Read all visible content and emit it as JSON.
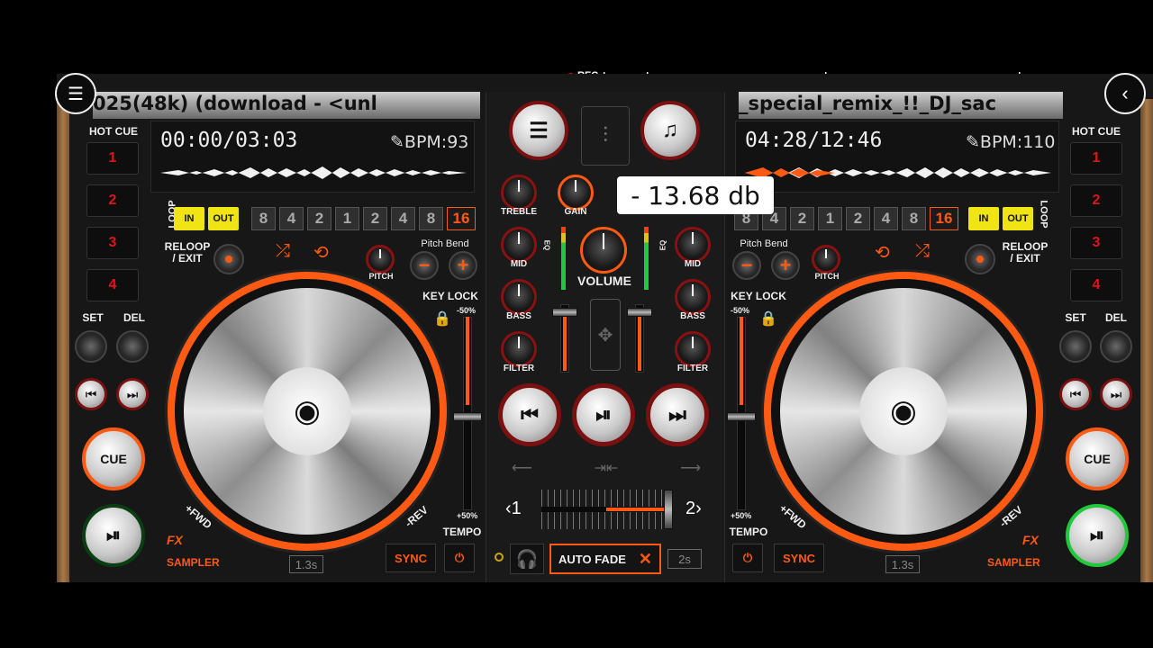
{
  "rec_label": "REC",
  "left": {
    "track": "025(48k) (download - <unl",
    "time": "00:00/03:03",
    "bpm": "BPM:93",
    "hot_cue_title": "HOT CUE",
    "hot_cues": [
      "1",
      "2",
      "3",
      "4"
    ],
    "set": "SET",
    "del": "DEL",
    "cue": "CUE",
    "fx": "FX",
    "sampler": "SAMPLER",
    "timer": "1.3s",
    "loop": "LOOP",
    "in": "IN",
    "out": "OUT",
    "loop_sizes": [
      "8",
      "4",
      "2",
      "1",
      "2",
      "4",
      "8",
      "16"
    ],
    "reloop": "RELOOP\n/ EXIT",
    "pitch_bend": "Pitch Bend",
    "pitch": "PITCH",
    "key_lock": "KEY LOCK",
    "range_top": "-50%",
    "range_bot": "+50%",
    "tempo": "TEMPO",
    "sync": "SYNC",
    "fwd": "+FWD",
    "rev": "-REV"
  },
  "right": {
    "track": "_special_remix_!!_DJ_sac",
    "time": "04:28/12:46",
    "bpm": "BPM:110",
    "hot_cue_title": "HOT CUE",
    "hot_cues": [
      "1",
      "2",
      "3",
      "4"
    ],
    "set": "SET",
    "del": "DEL",
    "cue": "CUE",
    "fx": "FX",
    "sampler": "SAMPLER",
    "timer": "1.3s",
    "loop": "LOOP",
    "in": "IN",
    "out": "OUT",
    "loop_sizes": [
      "8",
      "4",
      "2",
      "1",
      "2",
      "4",
      "8",
      "16"
    ],
    "reloop": "RELOOP\n/ EXIT",
    "pitch_bend": "Pitch Bend",
    "pitch": "PITCH",
    "key_lock": "KEY LOCK",
    "range_top": "-50%",
    "range_bot": "+50%",
    "tempo": "TEMPO",
    "sync": "SYNC",
    "fwd": "+FWD",
    "rev": "-REV"
  },
  "mixer": {
    "treble": "TREBLE",
    "gain": "GAIN",
    "mid": "MID",
    "bass": "BASS",
    "filter": "FILTER",
    "volume": "VOLUME",
    "eq": "EQ",
    "tooltip": "- 13.68 db",
    "auto_fade": "AUTO FADE",
    "fade_time": "2s",
    "ch1": "‹1",
    "ch2": "2›"
  },
  "colors": {
    "accent": "#ff5a14",
    "hotcue": "#e0141c",
    "yellow": "#f0e414",
    "green": "#22c83c"
  }
}
